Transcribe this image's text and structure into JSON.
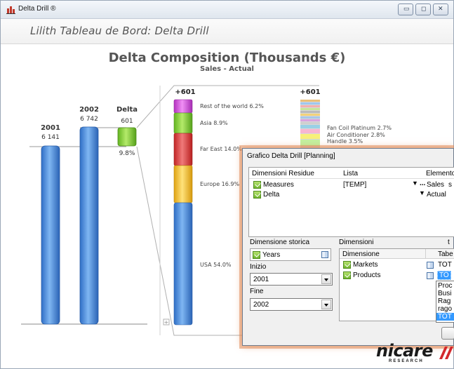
{
  "window": {
    "title": "Delta Drill ®",
    "subtitle": "Lilith Tableau de Bord: Delta Drill",
    "controls": [
      "minimize",
      "maximize",
      "close"
    ]
  },
  "chart": {
    "title": "Delta Composition (Thousands €)",
    "subtitle": "Sales - Actual",
    "left_bars": [
      {
        "year": "2001",
        "value_label": "6 141"
      },
      {
        "year": "2002",
        "value_label": "6 742"
      },
      {
        "year": "Delta",
        "value_label": "601",
        "pct": "9.8%"
      }
    ],
    "stack1_total": "+601",
    "stack1_segments": [
      {
        "label": "Rest of the world 6.2%",
        "pct": 6.2,
        "color": "#d94fe0"
      },
      {
        "label": "Asia 8.9%",
        "pct": 8.9,
        "color": "#7ccd2a"
      },
      {
        "label": "Far East 14.0%",
        "pct": 14.0,
        "color": "#dd3a3a"
      },
      {
        "label": "Europe 16.9%",
        "pct": 16.9,
        "color": "#f2bd22"
      },
      {
        "label": "USA 54.0%",
        "pct": 54.0,
        "color": "#4a8fe0"
      }
    ],
    "stack2_total": "+601",
    "stack2_labels": [
      "Fan Coil Platinum 2.7%",
      "Air Conditioner 2.8%",
      "Handle 3.5%"
    ]
  },
  "dialog": {
    "title": "Grafico Delta Drill [Planning]",
    "residual": {
      "headers": [
        "Dimensioni Residue",
        "Lista",
        "Elemento"
      ],
      "rows": [
        {
          "name": "Measures",
          "list": "[TEMP]",
          "more": "...",
          "element": "Sales",
          "extra": "s"
        },
        {
          "name": "Delta",
          "list": "",
          "element": "Actual"
        }
      ]
    },
    "history": {
      "label": "Dimensione storica",
      "value": "Years",
      "start_label": "Inizio",
      "start_value": "2001",
      "end_label": "Fine",
      "end_value": "2002"
    },
    "dimensions": {
      "label": "Dimensioni",
      "right_marker": "t",
      "headers": [
        "Dimensione",
        "Tabe"
      ],
      "rows": [
        {
          "name": "Markets",
          "table": "TOT"
        },
        {
          "name": "Products",
          "table": "TO"
        }
      ],
      "list_items": [
        "Proc",
        "Busi",
        "Rag",
        "rago",
        "TOT"
      ]
    }
  },
  "brand": {
    "logo_text": "nicare",
    "logo_sub": "RESEARCH"
  }
}
